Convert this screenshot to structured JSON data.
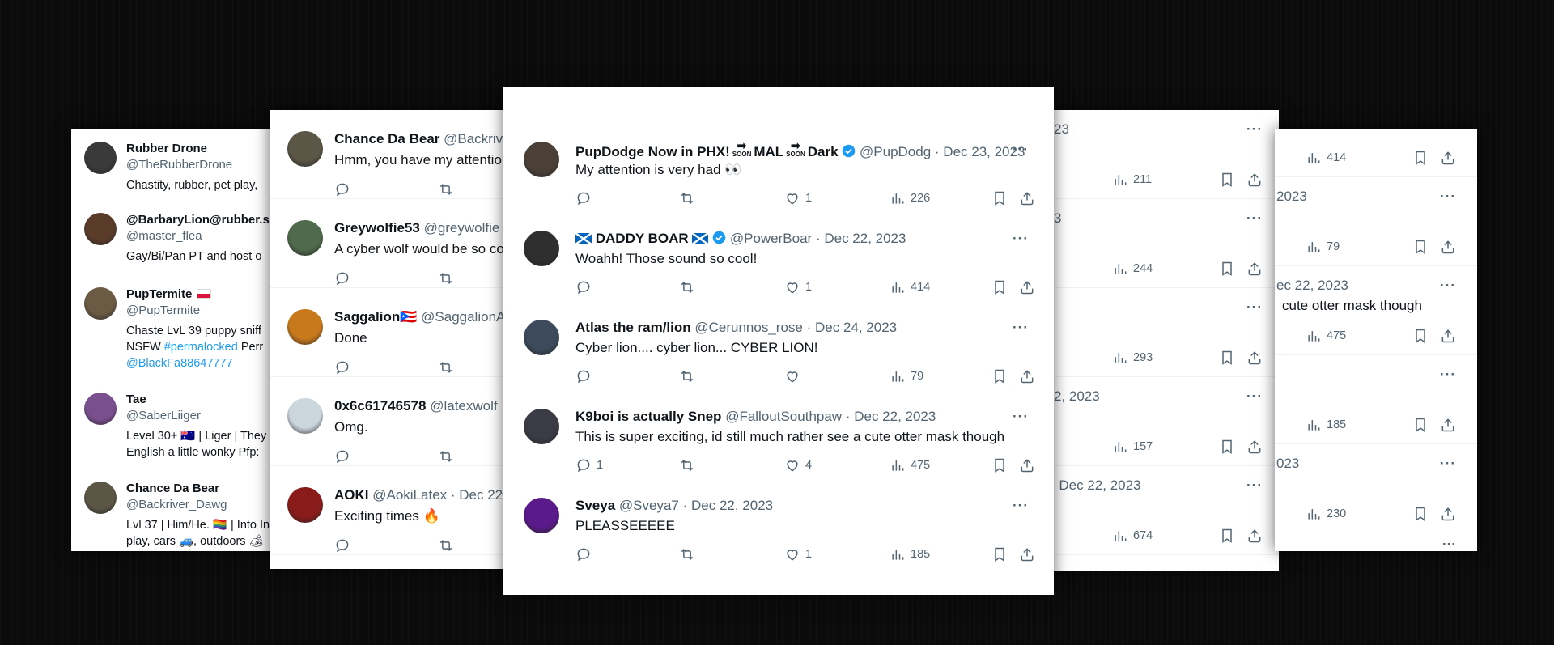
{
  "who_to_follow": [
    {
      "name": "Rubber Drone",
      "handle": "@TheRubberDrone",
      "bio": [
        "Chastity, rubber, pet play,"
      ],
      "avatar_color": "#3a3a3a"
    },
    {
      "name": "@BarbaryLion@rubber.sc",
      "handle": "@master_flea",
      "bio": [
        "Gay/Bi/Pan PT and host o"
      ],
      "avatar_color": "#5a3b2a"
    },
    {
      "name": "PupTermite",
      "handle": "@PupTermite",
      "bio": [
        "Chaste LvL 39 puppy sniff",
        "NSFW #permalocked Perr",
        "@BlackFa88647777"
      ],
      "avatar_color": "#6b5a44"
    },
    {
      "name": "Tae",
      "handle": "@SaberLiiger",
      "bio": [
        "Level 30+ 🇦🇺 | Liger | They",
        "English a little wonky Pfp:"
      ],
      "avatar_color": "#7a4f8f"
    },
    {
      "name": "Chance Da Bear",
      "handle": "@Backriver_Dawg",
      "bio": [
        "Lvl 37 | Him/He. 🏳️‍🌈 | Into In",
        "play, cars 🚙, outdoors 🏕"
      ],
      "avatar_color": "#5b5646"
    }
  ],
  "left_replies": [
    {
      "name": "Chance Da Bear",
      "handle": "@Backrive",
      "text": "Hmm, you have my attentio",
      "avatar_color": "#5b5646"
    },
    {
      "name": "Greywolfie53",
      "handle": "@greywolfie",
      "text": "A cyber wolf would be so co",
      "avatar_color": "#4f6a4c"
    },
    {
      "name": "Saggalion🇵🇷",
      "handle": "@SaggalionA",
      "text": "Done",
      "avatar_color": "#c8791c"
    },
    {
      "name": "0x6c61746578",
      "handle": "@latexwolf",
      "text": "Omg.",
      "avatar_color": "#ccd6dd"
    },
    {
      "name": "AOKI",
      "handle": "@AokiLatex · Dec 22,",
      "text": "Exciting times 🔥",
      "avatar_color": "#8a1b1b"
    }
  ],
  "main_tweets": [
    {
      "name_parts": [
        "PupDodge Now in PHX!",
        "MAL",
        "Dark"
      ],
      "soon_label": "SOON",
      "verified": true,
      "handle": "@PupDodg",
      "date": "· Dec 23, 2023",
      "text": "My attention is very had 👀",
      "replies": "",
      "likes": "1",
      "views": "226",
      "avatar_color": "#4a4038"
    },
    {
      "name_parts": [
        "DADDY BOAR"
      ],
      "verified": true,
      "flags": true,
      "handle": "@PowerBoar",
      "date": "· Dec 22, 2023",
      "text": "Woahh! Those sound so cool!",
      "replies": "",
      "likes": "1",
      "views": "414",
      "avatar_color": "#2f2f2f"
    },
    {
      "name_parts": [
        "Atlas the ram/lion"
      ],
      "verified": false,
      "handle": "@Cerunnos_rose",
      "date": "· Dec 24, 2023",
      "text": "Cyber lion.... cyber lion... CYBER LION!",
      "replies": "",
      "likes": "",
      "views": "79",
      "avatar_color": "#3c4a5c"
    },
    {
      "name_parts": [
        "K9boi is actually Snep"
      ],
      "verified": false,
      "handle": "@FalloutSouthpaw",
      "date": "· Dec 22, 2023",
      "text": "This is super exciting, id still much rather see a cute otter mask though",
      "replies": "1",
      "likes": "4",
      "views": "475",
      "avatar_color": "#3b3b45"
    },
    {
      "name_parts": [
        "Sveya"
      ],
      "verified": false,
      "handle": "@Sveya7",
      "date": "· Dec 22, 2023",
      "text": "PLEASSEEEEE",
      "replies": "",
      "likes": "1",
      "views": "185",
      "avatar_color": "#5a1a8a"
    }
  ],
  "right_panel_d": [
    {
      "date_fragment": "23",
      "views": "211"
    },
    {
      "date_fragment": "3",
      "views": "244"
    },
    {
      "date_fragment": "",
      "views": "293"
    },
    {
      "date_fragment": "2, 2023",
      "views": "157"
    },
    {
      "date_fragment": "· Dec 22, 2023",
      "views": "674"
    }
  ],
  "right_panel_e": [
    {
      "date_fragment": "",
      "text": "",
      "views": "414"
    },
    {
      "date_fragment": "2023",
      "text": "",
      "views": "79"
    },
    {
      "date_fragment": "ec 22, 2023",
      "text": "cute otter mask though",
      "views": "475"
    },
    {
      "date_fragment": "",
      "text": "",
      "views": "185"
    },
    {
      "date_fragment": "023",
      "text": "",
      "views": "230"
    }
  ],
  "more_glyph": "···",
  "colors": {
    "accent": "#1d9bf0",
    "muted": "#536471",
    "background": "#0b0b0b"
  }
}
